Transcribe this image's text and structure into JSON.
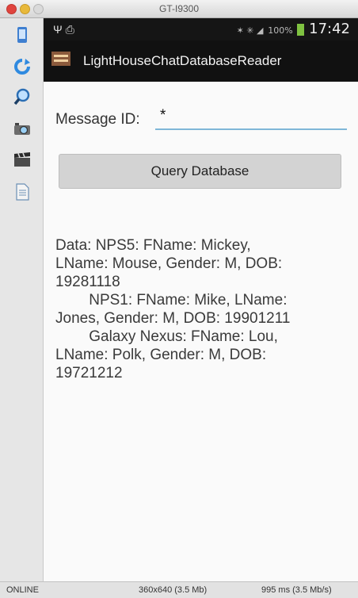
{
  "window": {
    "title": "GT-I9300"
  },
  "status_bar": {
    "left": "Ψ ⎙",
    "signal_icons": "✶ ✳ ◢",
    "battery_percent": "100%",
    "time": "17:42"
  },
  "app": {
    "title": "LightHouseChatDatabaseReader"
  },
  "form": {
    "message_id_label": "Message ID:",
    "message_id_value": "*",
    "query_button": "Query Database"
  },
  "result_text": "Data: NPS5: FName: Mickey,\nLName: Mouse, Gender: M, DOB:\n19281118\n        NPS1: FName: Mike, LName:\nJones, Gender: M, DOB: 19901211\n        Galaxy Nexus: FName: Lou,\nLName: Polk, Gender: M, DOB:\n19721212",
  "bottom_bar": {
    "status": "ONLINE",
    "resolution": "360x640 (3.5 Mb)",
    "timing": "995 ms (3.5 Mb/s)"
  },
  "colors": {
    "input_underline": "#7fb7d8",
    "battery": "#7fc241",
    "action_bar": "#111111"
  },
  "toolbar_icons": [
    "phone-icon",
    "rotate-icon",
    "zoom-icon",
    "camera-icon",
    "clapper-icon",
    "document-icon"
  ]
}
